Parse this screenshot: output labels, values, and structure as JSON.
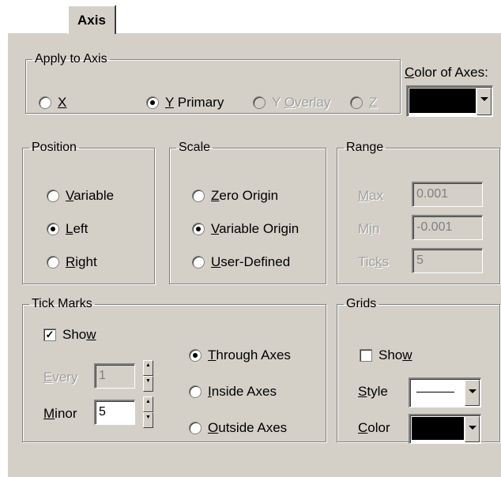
{
  "tab": {
    "label": "Axis"
  },
  "apply_to_axis": {
    "legend": "Apply to Axis",
    "options": [
      {
        "pre": "",
        "key": "X",
        "post": "",
        "selected": false,
        "disabled": false
      },
      {
        "pre": "",
        "key": "Y",
        "post": " Primary",
        "selected": true,
        "disabled": false
      },
      {
        "pre": "Y ",
        "key": "O",
        "post": "verlay",
        "selected": false,
        "disabled": true
      },
      {
        "pre": "",
        "key": "Z",
        "post": "",
        "selected": false,
        "disabled": true
      }
    ]
  },
  "color_of_axes": {
    "pre": "",
    "key": "C",
    "post": "olor of Axes:",
    "value": "#000000"
  },
  "position": {
    "legend": "Position",
    "options": [
      {
        "pre": "",
        "key": "V",
        "post": "ariable",
        "selected": false
      },
      {
        "pre": "",
        "key": "L",
        "post": "eft",
        "selected": true
      },
      {
        "pre": "",
        "key": "R",
        "post": "ight",
        "selected": false
      }
    ]
  },
  "scale": {
    "legend": "Scale",
    "options": [
      {
        "pre": "",
        "key": "Z",
        "post": "ero Origin",
        "selected": false
      },
      {
        "pre": "",
        "key": "V",
        "post": "ariable Origin",
        "selected": true
      },
      {
        "pre": "",
        "key": "U",
        "post": "ser-Defined",
        "selected": false
      }
    ]
  },
  "range": {
    "legend": "Range",
    "max": {
      "pre": "",
      "key": "M",
      "post": "ax",
      "value": "0.001"
    },
    "min": {
      "pre": "M",
      "key": "i",
      "post": "n",
      "value": "-0.001"
    },
    "ticks": {
      "pre": "Tic",
      "key": "k",
      "post": "s",
      "value": "5"
    }
  },
  "tick_marks": {
    "legend": "Tick Marks",
    "show": {
      "pre": "Sho",
      "key": "w",
      "post": "",
      "checked": true
    },
    "every": {
      "pre": "",
      "key": "E",
      "post": "very",
      "value": "1"
    },
    "minor": {
      "pre": "",
      "key": "M",
      "post": "inor",
      "value": "5"
    },
    "placement": [
      {
        "pre": "",
        "key": "T",
        "post": "hrough Axes",
        "selected": true
      },
      {
        "pre": "",
        "key": "I",
        "post": "nside Axes",
        "selected": false
      },
      {
        "pre": "",
        "key": "O",
        "post": "utside Axes",
        "selected": false
      }
    ]
  },
  "grids": {
    "legend": "Grids",
    "show": {
      "pre": "Sho",
      "key": "w",
      "post": "",
      "checked": false
    },
    "style": {
      "pre": "",
      "key": "S",
      "post": "tyle"
    },
    "color": {
      "pre": "",
      "key": "C",
      "post": "olor",
      "value": "#000000"
    }
  }
}
